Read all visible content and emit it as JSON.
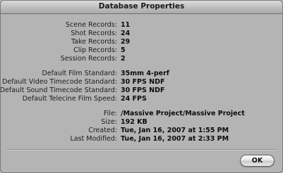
{
  "window": {
    "title": "Database Properties"
  },
  "records": [
    {
      "label": "Scene Records:",
      "value": "11"
    },
    {
      "label": "Shot Records:",
      "value": "24"
    },
    {
      "label": "Take Records:",
      "value": "29"
    },
    {
      "label": "Clip Records:",
      "value": "5"
    },
    {
      "label": "Session Records:",
      "value": "2"
    }
  ],
  "standards": [
    {
      "label": "Default Film Standard:",
      "value": "35mm 4-perf"
    },
    {
      "label": "Default Video Timecode Standard:",
      "value": "30 FPS NDF"
    },
    {
      "label": "Default Sound Timecode Standard:",
      "value": "30 FPS NDF"
    },
    {
      "label": "Default Telecine Film Speed:",
      "value": "24 FPS"
    }
  ],
  "file_info": [
    {
      "label": "File:",
      "value": "/Massive Project/Massive Project"
    },
    {
      "label": "Size:",
      "value": "192 KB"
    },
    {
      "label": "Created:",
      "value": "Tue, Jan 16, 2007 at 1:55 PM"
    },
    {
      "label": "Last Modified:",
      "value": "Tue, Jan 16, 2007 at 2:33 PM"
    }
  ],
  "buttons": {
    "ok_label": "OK"
  }
}
